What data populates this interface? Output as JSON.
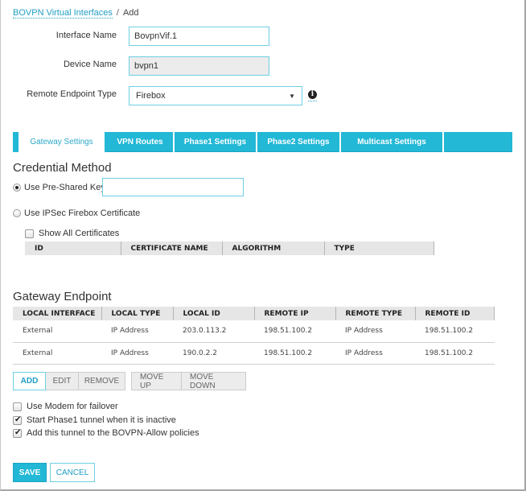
{
  "breadcrumb": {
    "parent": "BOVPN Virtual Interfaces",
    "separator": "/",
    "current": "Add"
  },
  "form": {
    "interface_name": {
      "label": "Interface Name",
      "value": "BovpnVif.1"
    },
    "device_name": {
      "label": "Device Name",
      "value": "bvpn1"
    },
    "remote_endpoint_type": {
      "label": "Remote Endpoint Type",
      "value": "Firebox",
      "info_icon": "info-icon"
    }
  },
  "tabs": [
    {
      "label": "Gateway Settings",
      "active": true
    },
    {
      "label": "VPN Routes",
      "active": false
    },
    {
      "label": "Phase1 Settings",
      "active": false
    },
    {
      "label": "Phase2 Settings",
      "active": false
    },
    {
      "label": "Multicast Settings",
      "active": false
    }
  ],
  "credential": {
    "title": "Credential Method",
    "psk_label": "Use Pre-Shared Key",
    "psk_value": "",
    "psk_selected": true,
    "cert_label": "Use IPSec Firebox Certificate",
    "cert_selected": false,
    "show_all_label": "Show All Certificates",
    "show_all_checked": false,
    "cert_columns": [
      "ID",
      "CERTIFICATE NAME",
      "ALGORITHM",
      "TYPE"
    ]
  },
  "gateway": {
    "title": "Gateway Endpoint",
    "columns": [
      "LOCAL INTERFACE",
      "LOCAL TYPE",
      "LOCAL ID",
      "REMOTE IP",
      "REMOTE TYPE",
      "REMOTE ID"
    ],
    "rows": [
      [
        "External",
        "IP Address",
        "203.0.113.2",
        "198.51.100.2",
        "IP Address",
        "198.51.100.2"
      ],
      [
        "External",
        "IP Address",
        "190.0.2.2",
        "198.51.100.2",
        "IP Address",
        "198.51.100.2"
      ]
    ],
    "buttons": {
      "add": "ADD",
      "edit": "EDIT",
      "remove": "REMOVE",
      "move_up": "MOVE UP",
      "move_down": "MOVE DOWN"
    }
  },
  "options": [
    {
      "label": "Use Modem for failover",
      "checked": false
    },
    {
      "label": "Start Phase1 tunnel when it is inactive",
      "checked": true
    },
    {
      "label": "Add this tunnel to the BOVPN-Allow policies",
      "checked": true
    }
  ],
  "footer": {
    "save": "SAVE",
    "cancel": "CANCEL"
  }
}
